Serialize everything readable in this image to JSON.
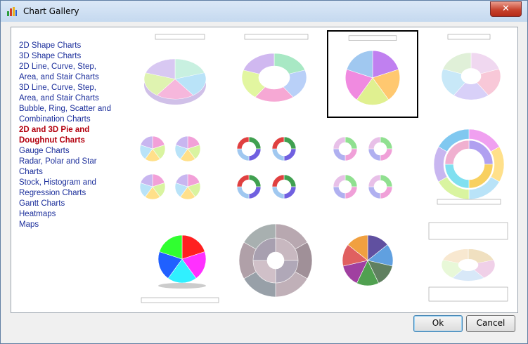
{
  "window": {
    "title": "Chart Gallery",
    "close_label": "✕"
  },
  "categories": [
    {
      "lines": [
        "2D Shape Charts"
      ],
      "selected": false
    },
    {
      "lines": [
        "3D Shape Charts"
      ],
      "selected": false
    },
    {
      "lines": [
        "2D Line, Curve, Step,",
        "Area, and Stair Charts"
      ],
      "selected": false
    },
    {
      "lines": [
        "3D Line, Curve, Step,",
        "Area, and Stair Charts"
      ],
      "selected": false
    },
    {
      "lines": [
        "Bubble, Ring, Scatter and",
        "Combination Charts"
      ],
      "selected": false
    },
    {
      "lines": [
        "2D and 3D Pie and",
        "Doughnut Charts"
      ],
      "selected": true
    },
    {
      "lines": [
        "Gauge Charts"
      ],
      "selected": false
    },
    {
      "lines": [
        "Radar, Polar and Star",
        "Charts"
      ],
      "selected": false
    },
    {
      "lines": [
        "Stock, Histogram and",
        "Regression Charts"
      ],
      "selected": false
    },
    {
      "lines": [
        "Gantt Charts"
      ],
      "selected": false
    },
    {
      "lines": [
        "Heatmaps"
      ],
      "selected": false
    },
    {
      "lines": [
        "Maps"
      ],
      "selected": false
    }
  ],
  "thumbnails": [
    {
      "name": "3d-pie-exploded-thumbnail",
      "selected": false
    },
    {
      "name": "3d-doughnut-thumbnail",
      "selected": false
    },
    {
      "name": "exploded-pie-labels-thumbnail",
      "selected": true
    },
    {
      "name": "3d-doughnut-exploded-thumbnail",
      "selected": false
    },
    {
      "name": "multi-pie-grid-thumbnail",
      "selected": false
    },
    {
      "name": "multi-doughnut-grid-thumbnail",
      "selected": false
    },
    {
      "name": "dotted-doughnut-grid-thumbnail",
      "selected": false
    },
    {
      "name": "multi-ring-doughnut-thumbnail",
      "selected": false
    },
    {
      "name": "3d-pie-gradient-thumbnail",
      "selected": false
    },
    {
      "name": "3d-multi-ring-doughnut-thumbnail",
      "selected": false
    },
    {
      "name": "pie-with-callouts-thumbnail",
      "selected": false
    },
    {
      "name": "3d-doughnut-with-table-thumbnail",
      "selected": false
    }
  ],
  "buttons": {
    "ok": "Ok",
    "cancel": "Cancel"
  },
  "colors": {
    "link": "#1b2e9b",
    "selected_link": "#b3000e"
  }
}
